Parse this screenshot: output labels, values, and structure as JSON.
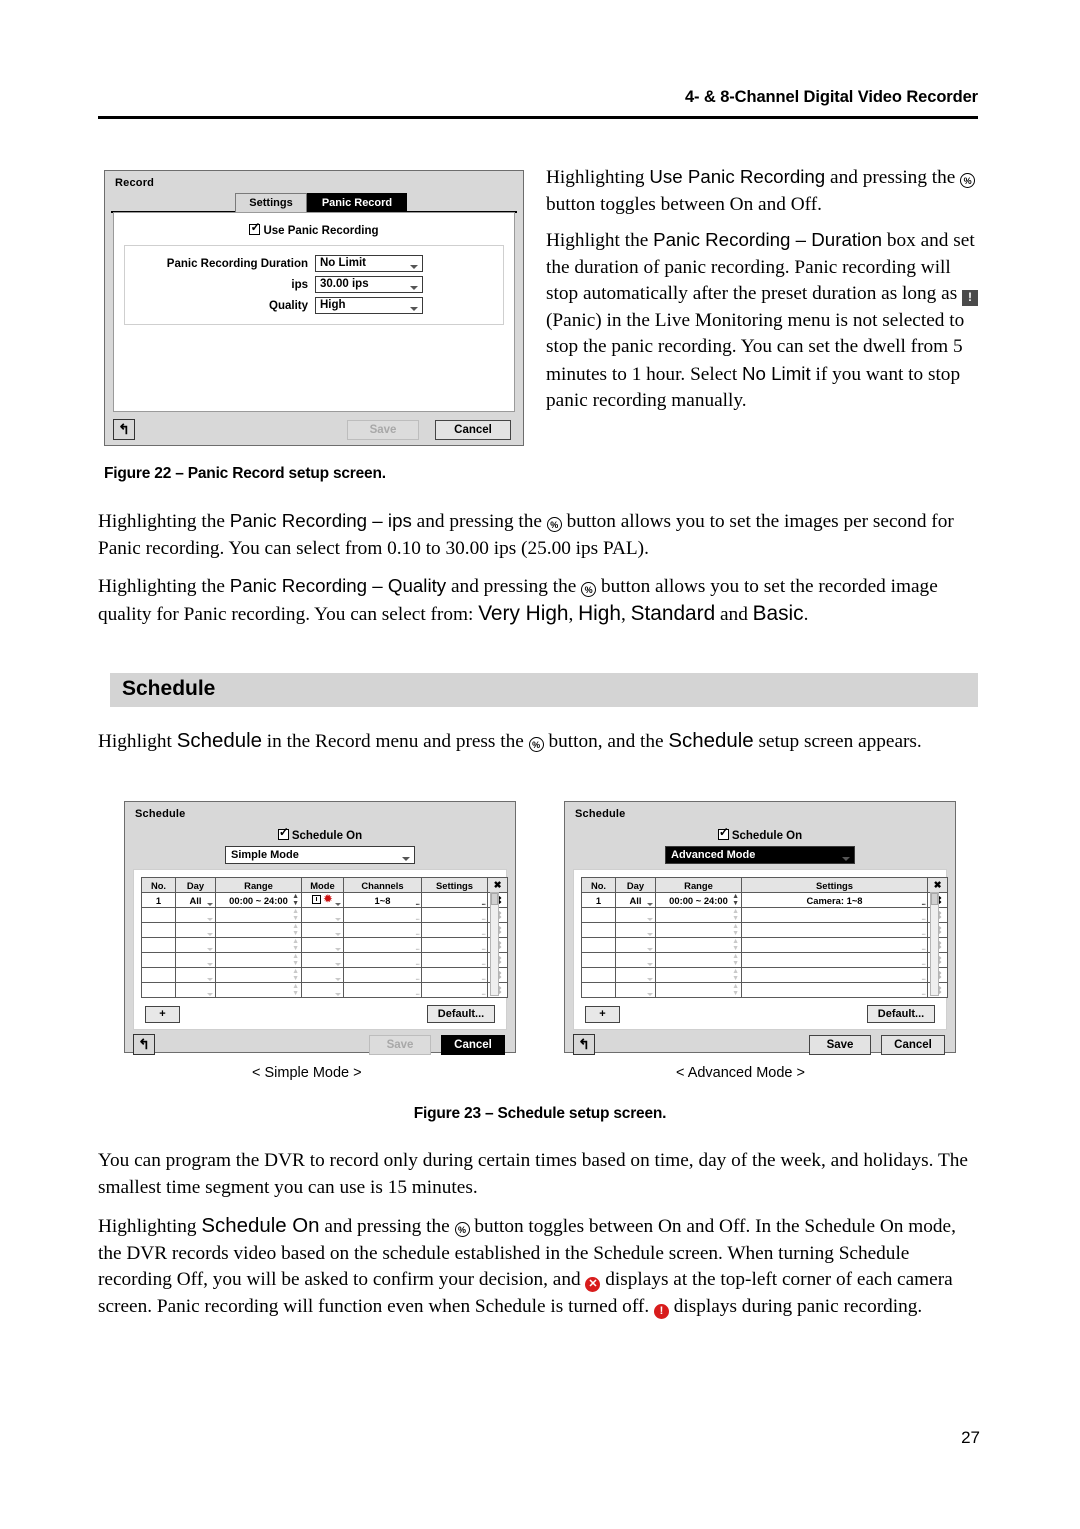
{
  "header": {
    "title": "4- & 8-Channel Digital Video Recorder"
  },
  "page_number": "27",
  "figure22": {
    "dialog": {
      "title": "Record",
      "tabs": [
        {
          "label": "Settings",
          "selected": false
        },
        {
          "label": "Panic Record",
          "selected": true
        }
      ],
      "checkbox": {
        "label": "Use Panic Recording",
        "checked": true
      },
      "fields": [
        {
          "label": "Panic Recording Duration",
          "value": "No Limit"
        },
        {
          "label": "ips",
          "value": "30.00 ips"
        },
        {
          "label": "Quality",
          "value": "High"
        }
      ],
      "back_icon": "↰",
      "save_label": "Save",
      "cancel_label": "Cancel"
    },
    "caption": "Figure 22 – Panic Record setup screen."
  },
  "right_column": {
    "p1": {
      "a": "Highlighting ",
      "ui1": "Use Panic Recording",
      "b": " and pressing the ",
      "icon": "%",
      "c": " button toggles between On and Off."
    },
    "p2": {
      "a": "Highlight the ",
      "ui1": "Panic Recording – Duration",
      "b": " box and set the duration of panic recording.  Panic recording will stop automatically after the preset duration as long as ",
      "panic_icon": "!",
      "c": " (Panic) in the Live Monitoring menu is not selected to stop the panic recording.  You can set the dwell from 5 minutes to 1 hour.  Select ",
      "ui2": "No Limit",
      "d": " if you want to stop panic recording manually."
    }
  },
  "paragraphs": {
    "ips": {
      "a": "Highlighting the ",
      "ui1": "Panic Recording – ips",
      "b": " and pressing the ",
      "icon": "%",
      "c": " button allows you to set the images per second for Panic recording.  You can select from 0.10 to 30.00 ips (25.00 ips PAL)."
    },
    "quality": {
      "a": "Highlighting the ",
      "ui1": "Panic Recording – Quality",
      "b": " and pressing the ",
      "icon": "%",
      "c": " button allows you to set the recorded image quality for Panic recording.  You can select from:  ",
      "ui2": "Very High",
      "d": ", ",
      "ui3": "High",
      "e": ", ",
      "ui4": "Standard",
      "f": " and ",
      "ui5": "Basic",
      "g": "."
    },
    "schedule_intro": {
      "a": "Highlight ",
      "ui1": "Schedule",
      "b": " in the Record menu and press the ",
      "icon": "%",
      "c": " button, and the ",
      "ui2": "Schedule",
      "d": " setup screen appears."
    },
    "program": "You can program the DVR to record only during certain times based on time, day of the week, and holidays.  The smallest time segment you can use is 15 minutes.",
    "schedule_on": {
      "a": "Highlighting ",
      "ui1": "Schedule On",
      "b": " and pressing the ",
      "icon": "%",
      "c": " button toggles between On and Off.  In the Schedule On mode, the DVR records video based on the schedule established in the Schedule screen.  When turning Schedule recording Off, you will be asked to confirm your decision, and ",
      "off_icon": "✕",
      "d": " displays at the top-left corner of each camera screen.  Panic recording will function even when Schedule is turned off.  ",
      "panic_icon": "!",
      "e": " displays during panic recording."
    }
  },
  "section_schedule": {
    "heading": "Schedule"
  },
  "figure23": {
    "caption": "Figure 23 – Schedule setup screen.",
    "simple_label": "< Simple Mode >",
    "advanced_label": "< Advanced Mode >",
    "simple": {
      "title": "Schedule",
      "checkbox": {
        "label": "Schedule On",
        "checked": true
      },
      "mode_value": "Simple Mode",
      "mode_selected": false,
      "columns": [
        "No.",
        "Day",
        "Range",
        "Mode",
        "Channels",
        "Settings",
        "✖"
      ],
      "row": {
        "no": "1",
        "day": "All",
        "range": "00:00 ~ 24:00",
        "mode_icons": [
          "clock-icon",
          "event-icon"
        ],
        "channels": "1~8",
        "settings": ""
      },
      "empty_rows": 6,
      "plus_label": "+",
      "default_label": "Default...",
      "back_icon": "↰",
      "save_label": "Save",
      "save_disabled": true,
      "cancel_label": "Cancel",
      "cancel_highlighted": true
    },
    "advanced": {
      "title": "Schedule",
      "checkbox": {
        "label": "Schedule On",
        "checked": true
      },
      "mode_value": "Advanced Mode",
      "mode_selected": true,
      "columns": [
        "No.",
        "Day",
        "Range",
        "Settings",
        "✖"
      ],
      "row": {
        "no": "1",
        "day": "All",
        "range": "00:00 ~ 24:00",
        "settings": "Camera: 1~8"
      },
      "empty_rows": 6,
      "plus_label": "+",
      "default_label": "Default...",
      "back_icon": "↰",
      "save_label": "Save",
      "save_disabled": false,
      "cancel_label": "Cancel",
      "cancel_highlighted": false
    }
  }
}
